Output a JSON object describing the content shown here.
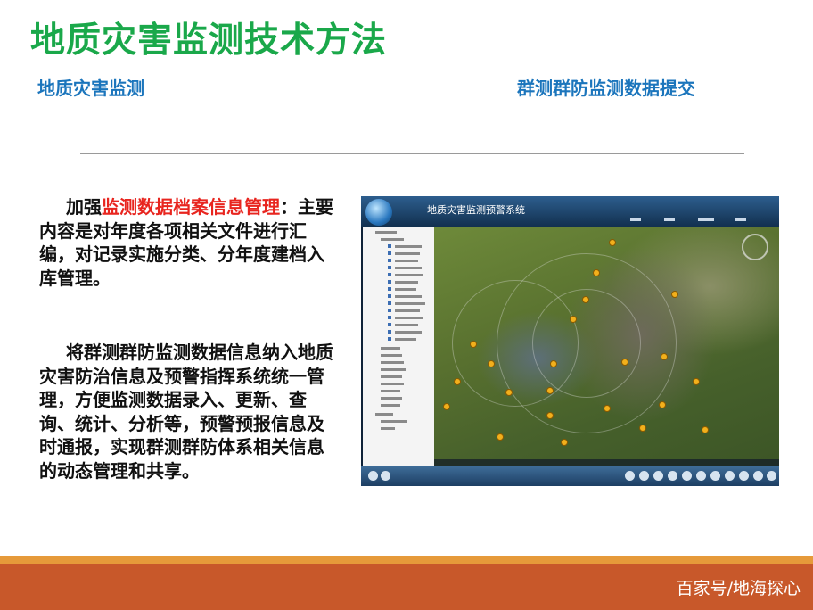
{
  "slide": {
    "title": "地质灾害监测技术方法",
    "subtitle_left": "地质灾害监测",
    "subtitle_right": "群测群防监测数据提交"
  },
  "paragraph1": {
    "prefix": "加强",
    "highlight": "监测数据档案信息管理",
    "rest": "：主要内容是对年度各项相关文件进行汇编，对记录实施分类、分年度建档入库管理。"
  },
  "paragraph2": {
    "text": "将群测群防监测数据信息纳入地质灾害防治信息及预警指挥系统统一管理，方便监测数据录入、更新、查询、统计、分析等，预警预报信息及时通报，实现群测群防体系相关信息的动态管理和共享。"
  },
  "embedded_app": {
    "title": "地质灾害监测预警系统"
  },
  "footer": {
    "watermark": "百家号/地海探心"
  },
  "colors": {
    "title_green": "#1aa84a",
    "subtitle_blue": "#1b75bc",
    "highlight_red": "#e8251f",
    "footer_orange": "#c8582a"
  }
}
